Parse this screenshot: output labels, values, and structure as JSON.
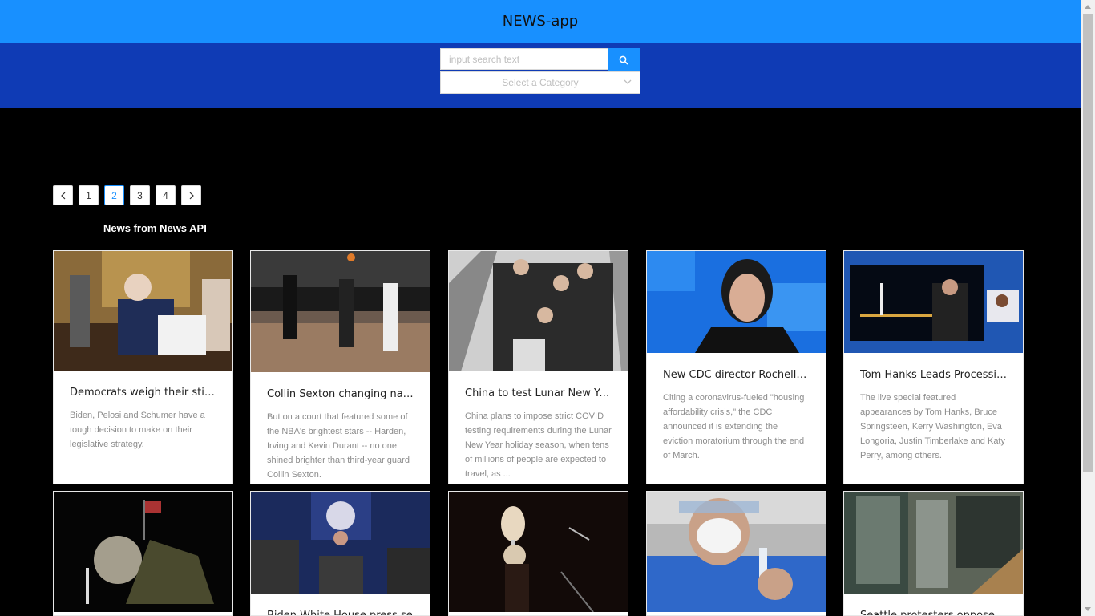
{
  "header": {
    "title": "NEWS-app"
  },
  "search": {
    "placeholder": "input search text",
    "category_placeholder": "Select a Category"
  },
  "pagination": {
    "prev": "<",
    "next": ">",
    "pages": [
      "1",
      "2",
      "3",
      "4"
    ],
    "current": "2"
  },
  "section_title": "News from News API",
  "articles": [
    {
      "title": "Democrats weigh their stim...",
      "description": "Biden, Pelosi and Schumer have a tough decision to make on their legislative strategy."
    },
    {
      "title": "Collin Sexton changing narr...",
      "description": "But on a court that featured some of the NBA's brightest stars -- Harden, Irving and Kevin Durant -- no one shined brighter than third-year guard Collin Sexton."
    },
    {
      "title": "China to test Lunar New Yea...",
      "description": "China plans to impose strict COVID testing requirements during the Lunar New Year holiday season, when tens of millions of people are expected to travel, as ..."
    },
    {
      "title": "New CDC director Rochelle ...",
      "description": "Citing a coronavirus-fueled \"housing affordability crisis,\" the CDC announced it is extending the eviction moratorium through the end of March."
    },
    {
      "title": "Tom Hanks Leads Processio...",
      "description": "The live special featured appearances by Tom Hanks, Bruce Springsteen, Kerry Washington, Eva Longoria, Justin Timberlake and Katy Perry, among others."
    },
    {
      "title": "",
      "description": ""
    },
    {
      "title": "Biden White House press se",
      "description": ""
    },
    {
      "title": "",
      "description": ""
    },
    {
      "title": "",
      "description": ""
    },
    {
      "title": "Seattle protesters oppose Bi",
      "description": ""
    }
  ],
  "colors": {
    "header_bg": "#1890ff",
    "search_bg": "#0f3bb5",
    "accent": "#1890ff"
  }
}
